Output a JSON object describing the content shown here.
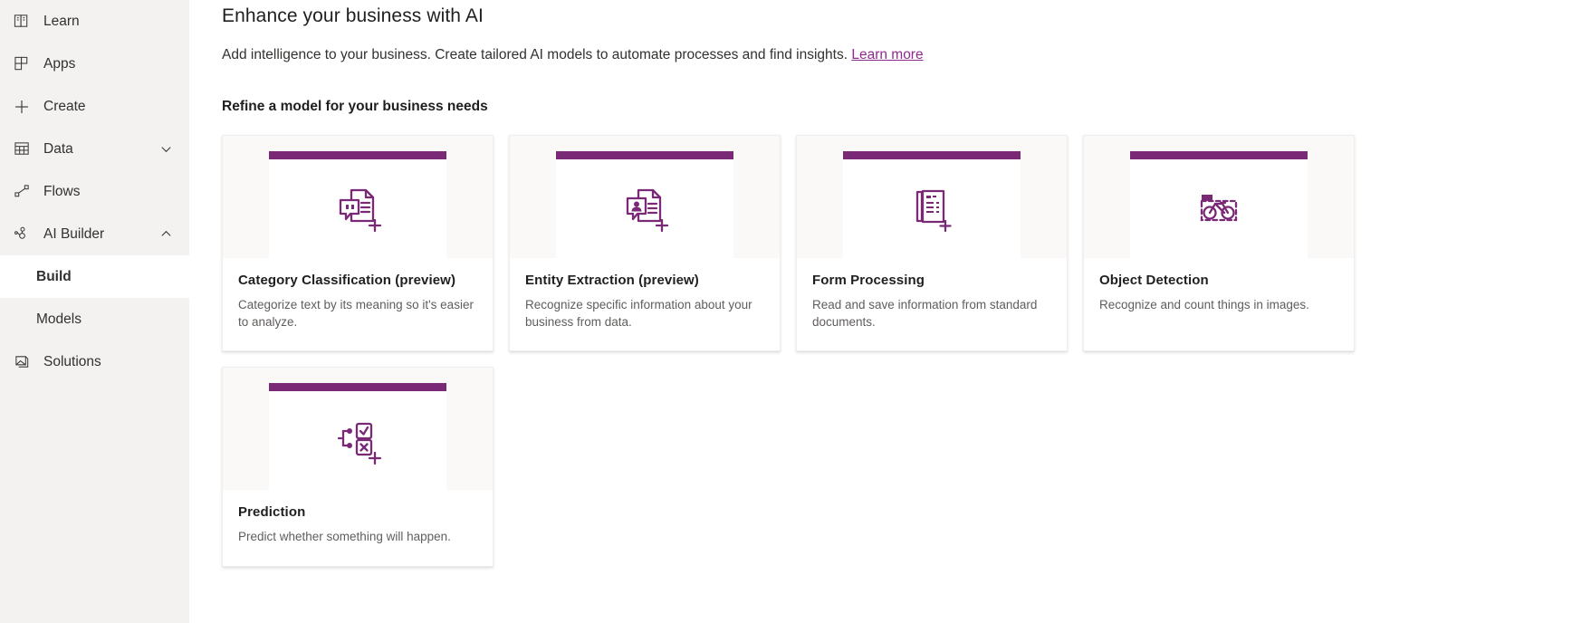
{
  "sidebar": {
    "items": [
      {
        "label": "Learn",
        "icon": "book-icon",
        "type": "item",
        "expandable": false
      },
      {
        "label": "Apps",
        "icon": "apps-icon",
        "type": "item",
        "expandable": false
      },
      {
        "label": "Create",
        "icon": "plus-icon",
        "type": "item",
        "expandable": false
      },
      {
        "label": "Data",
        "icon": "table-icon",
        "type": "item",
        "expandable": true,
        "chevron": "chevron-down-icon"
      },
      {
        "label": "Flows",
        "icon": "flows-icon",
        "type": "item",
        "expandable": false
      },
      {
        "label": "AI Builder",
        "icon": "ai-builder-icon",
        "type": "item",
        "expandable": true,
        "chevron": "chevron-up-icon"
      },
      {
        "label": "Build",
        "icon": "",
        "type": "sub",
        "selected": true
      },
      {
        "label": "Models",
        "icon": "",
        "type": "sub",
        "selected": false
      },
      {
        "label": "Solutions",
        "icon": "solutions-icon",
        "type": "item",
        "expandable": false
      }
    ]
  },
  "header": {
    "title": "Enhance your business with AI",
    "description": "Add intelligence to your business. Create tailored AI models to automate processes and find insights.",
    "learn_more_label": "Learn more"
  },
  "section": {
    "title": "Refine a model for your business needs"
  },
  "cards": [
    {
      "title": "Category Classification (preview)",
      "description": "Categorize text by its meaning so it's easier to analyze.",
      "icon": "document-comment-plus-icon"
    },
    {
      "title": "Entity Extraction (preview)",
      "description": "Recognize specific information about your business from data.",
      "icon": "document-person-plus-icon"
    },
    {
      "title": "Form Processing",
      "description": "Read and save information from standard documents.",
      "icon": "forms-stack-plus-icon"
    },
    {
      "title": "Object Detection",
      "description": "Recognize and count things in images.",
      "icon": "bicycle-bounding-box-icon"
    },
    {
      "title": "Prediction",
      "description": "Predict whether something will happen.",
      "icon": "prediction-branch-plus-icon"
    }
  ],
  "colors": {
    "accent_purple": "#7a2976",
    "link_purple": "#8f2b8f",
    "sidebar_bg": "#f3f2f1",
    "card_art_bg": "#faf9f8",
    "text_primary": "#201f1e",
    "text_secondary": "#605e5c"
  }
}
